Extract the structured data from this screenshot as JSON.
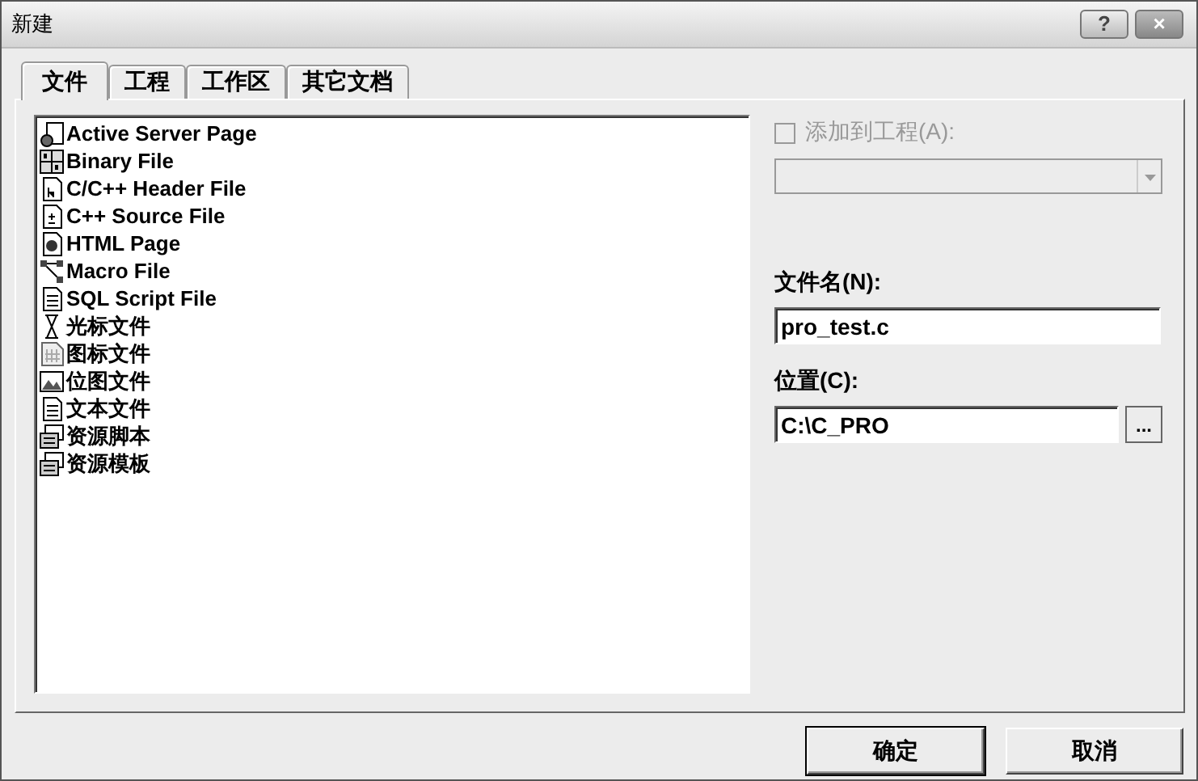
{
  "window": {
    "title": "新建",
    "help_button": "?",
    "close_button": "×"
  },
  "tabs": [
    {
      "label": "文件",
      "selected": true
    },
    {
      "label": "工程",
      "selected": false
    },
    {
      "label": "工作区",
      "selected": false
    },
    {
      "label": "其它文档",
      "selected": false
    }
  ],
  "file_types": [
    {
      "label": "Active Server Page",
      "kind": "asp"
    },
    {
      "label": "Binary File",
      "kind": "binary"
    },
    {
      "label": "C/C++ Header File",
      "kind": "header"
    },
    {
      "label": "C++ Source File",
      "kind": "source"
    },
    {
      "label": "HTML Page",
      "kind": "html"
    },
    {
      "label": "Macro File",
      "kind": "macro"
    },
    {
      "label": "SQL Script File",
      "kind": "text"
    },
    {
      "label": "光标文件",
      "kind": "cursor"
    },
    {
      "label": "图标文件",
      "kind": "icon"
    },
    {
      "label": "位图文件",
      "kind": "bitmap"
    },
    {
      "label": "文本文件",
      "kind": "text"
    },
    {
      "label": "资源脚本",
      "kind": "resource"
    },
    {
      "label": "资源模板",
      "kind": "resource"
    }
  ],
  "add_to_project": {
    "label": "添加到工程(A):",
    "checked": false,
    "disabled": true
  },
  "file_name": {
    "label": "文件名(N):",
    "value": "pro_test.c"
  },
  "location": {
    "label": "位置(C):",
    "value": "C:\\C_PRO",
    "browse_button": "..."
  },
  "buttons": [
    {
      "label": "确定",
      "default": true
    },
    {
      "label": "取消",
      "default": false
    }
  ]
}
